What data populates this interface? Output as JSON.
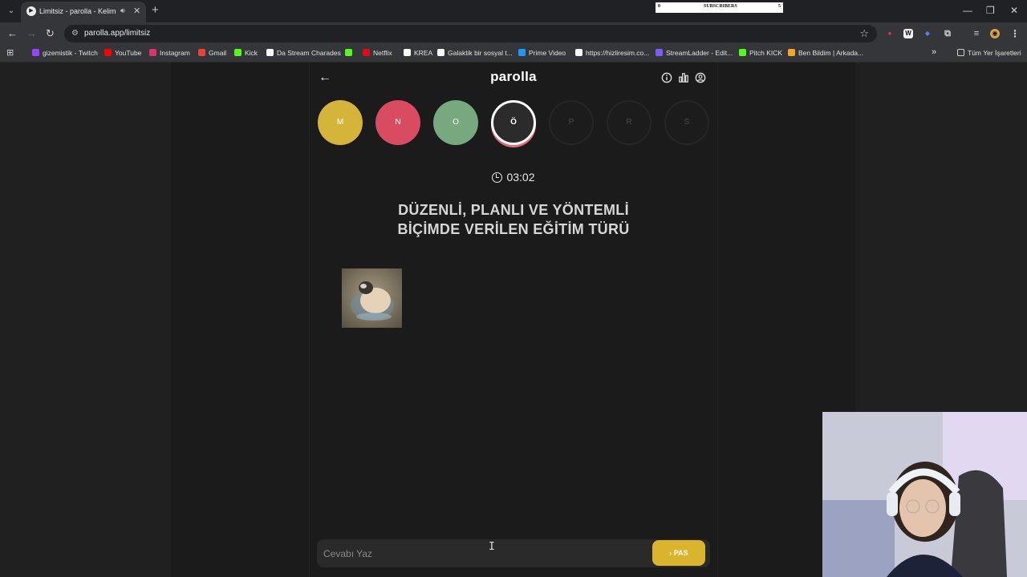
{
  "browser": {
    "tab": {
      "title": "Limitsiz - parolla - Kelime o",
      "favicon": "play-icon"
    },
    "url": "parolla.app/limitsiz",
    "subscribers_widget": {
      "left": "0",
      "label": "SUBSCRIBERS",
      "right": "5"
    },
    "bookmarks": [
      {
        "label": "gizemistik - Twitch",
        "icon": "twitch-icon",
        "color": "#9147ff"
      },
      {
        "label": "YouTube",
        "icon": "youtube-icon",
        "color": "#ff0000"
      },
      {
        "label": "Instagram",
        "icon": "instagram-icon",
        "color": "#e1306c"
      },
      {
        "label": "Gmail",
        "icon": "gmail-icon",
        "color": "#ea4335"
      },
      {
        "label": "Kick",
        "icon": "kick-icon",
        "color": "#53fc18"
      },
      {
        "label": "Da Stream Charades",
        "icon": "charades-icon",
        "color": "#ffffff"
      },
      {
        "label": "",
        "icon": "kick-icon",
        "color": "#53fc18"
      },
      {
        "label": "Netflix",
        "icon": "netflix-icon",
        "color": "#e50914"
      },
      {
        "label": "KREA",
        "icon": "krea-icon",
        "color": "#ffffff"
      },
      {
        "label": "Galaktik bir sosyal t...",
        "icon": "zk-icon",
        "color": "#ffffff"
      },
      {
        "label": "Prime Video",
        "icon": "prime-video-icon",
        "color": "#1a98ff"
      },
      {
        "label": "https://hizliresim.co...",
        "icon": "hizliresim-icon",
        "color": "#ffffff"
      },
      {
        "label": "StreamLadder - Edit...",
        "icon": "streamladder-icon",
        "color": "#7b5cff"
      },
      {
        "label": "Pitch KICK",
        "icon": "kick-icon",
        "color": "#53fc18"
      },
      {
        "label": "Ben Bildim | Arkada...",
        "icon": "benbildim-icon",
        "color": "#f5a623"
      }
    ],
    "all_bookmarks_label": "Tüm Yer İşaretleri"
  },
  "app": {
    "logo": "parolla",
    "letters": [
      {
        "letter": "M",
        "state": "correct",
        "color": "#d4b53a"
      },
      {
        "letter": "N",
        "state": "wrong",
        "color": "#d94b60"
      },
      {
        "letter": "O",
        "state": "passed",
        "color": "#78a97e"
      },
      {
        "letter": "Ö",
        "state": "current",
        "color": "#2b2b2b"
      },
      {
        "letter": "P",
        "state": "pending",
        "color": "#1c1c1c"
      },
      {
        "letter": "R",
        "state": "pending",
        "color": "#1c1c1c"
      },
      {
        "letter": "S",
        "state": "pending",
        "color": "#1c1c1c"
      }
    ],
    "timer": "03:02",
    "question_line1": "DÜZENLİ, PLANLI VE YÖNTEMLİ",
    "question_line2": "BİÇİMDE VERİLEN EĞİTİM TÜRÜ",
    "answer_placeholder": "Cevabı Yaz",
    "pass_label": "PAS"
  }
}
